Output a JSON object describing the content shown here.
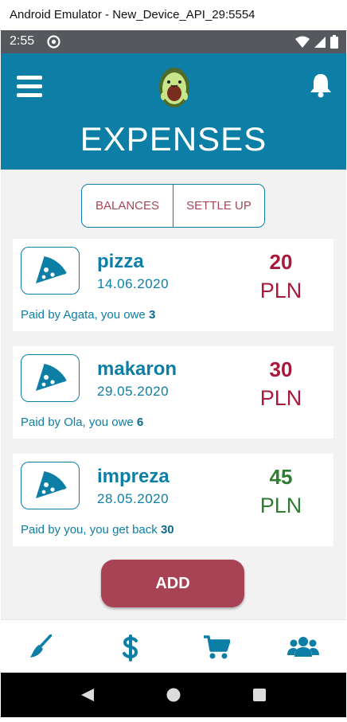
{
  "window": {
    "title": "Android Emulator - New_Device_API_29:5554"
  },
  "status_bar": {
    "time": "2:55"
  },
  "header": {
    "title": "EXPENSES"
  },
  "tabs": [
    {
      "label": "BALANCES"
    },
    {
      "label": "SETTLE UP"
    }
  ],
  "expenses": [
    {
      "name": "pizza",
      "date": "14.06.2020",
      "amount": "20",
      "currency": "PLN",
      "note_prefix": "Paid by Agata, you owe",
      "note_value": "3",
      "status": "owe"
    },
    {
      "name": "makaron",
      "date": "29.05.2020",
      "amount": "30",
      "currency": "PLN",
      "note_prefix": "Paid by Ola, you owe",
      "note_value": "6",
      "status": "owe"
    },
    {
      "name": "impreza",
      "date": "28.05.2020",
      "amount": "45",
      "currency": "PLN",
      "note_prefix": "Paid by you, you get back",
      "note_value": "30",
      "status": "get"
    }
  ],
  "actions": {
    "add_label": "ADD"
  },
  "bottom_nav": [
    {
      "icon": "broom-icon"
    },
    {
      "icon": "dollar-icon"
    },
    {
      "icon": "cart-icon"
    },
    {
      "icon": "group-icon"
    }
  ],
  "colors": {
    "primary": "#0d7fa6",
    "owe": "#a8193b",
    "get": "#2e7d32",
    "add_button": "#a84255"
  }
}
